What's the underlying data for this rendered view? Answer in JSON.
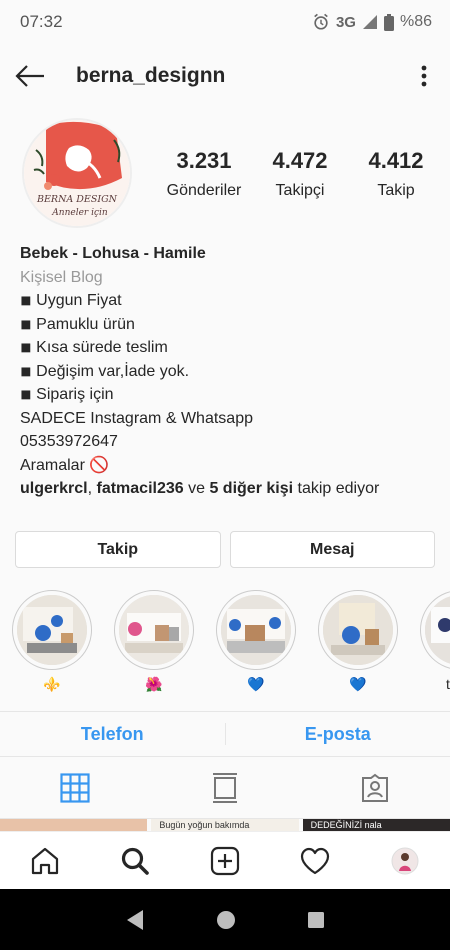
{
  "status_bar": {
    "time": "07:32",
    "network": "3G",
    "battery": "%86"
  },
  "header": {
    "username": "berna_designn"
  },
  "avatar": {
    "brand_line1": "BERNA DESIGN",
    "brand_line2": "Anneler için"
  },
  "stats": [
    {
      "value": "3.231",
      "label": "Gönderiler"
    },
    {
      "value": "4.472",
      "label": "Takipçi"
    },
    {
      "value": "4.412",
      "label": "Takip"
    }
  ],
  "bio": {
    "name": "Bebek - Lohusa - Hamile",
    "category": "Kişisel Blog",
    "lines": [
      "◾ Uygun Fiyat",
      "◾ Pamuklu ürün",
      "◾  Kısa sürede teslim",
      "◾  Değişim var,İade yok.",
      "◾   Sipariş için",
      " SADECE Instagram &  Whatsapp",
      "05353972647",
      "Aramalar 🚫"
    ],
    "followed_by_1": "ulgerkrcl",
    "followed_sep": ", ",
    "followed_by_2": "fatmacil236",
    "followed_and": " ve ",
    "followed_others": "5 diğer kişi",
    "followed_suffix": " takip ediyor"
  },
  "actions": {
    "follow": "Takip",
    "message": "Mesaj"
  },
  "highlights": [
    {
      "label": "⚜️"
    },
    {
      "label": "🌺"
    },
    {
      "label": "💙"
    },
    {
      "label": "💙"
    },
    {
      "label": "taraf"
    }
  ],
  "contact": {
    "phone": "Telefon",
    "email": "E-posta"
  },
  "grid_peek": [
    "",
    "Bugün yoğun bakımda",
    "DEDEĞİNİZİ nala"
  ],
  "colors": {
    "link_blue": "#3897f0",
    "tab_active": "#3897f0",
    "avatar_bg": "#e8594b"
  }
}
